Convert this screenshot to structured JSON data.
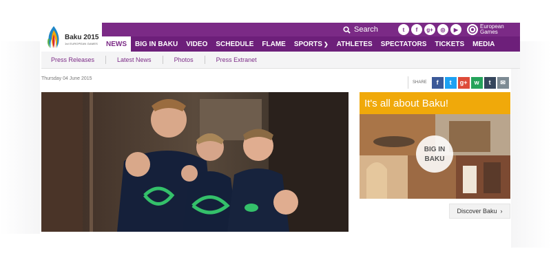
{
  "brand": {
    "name": "Baku 2015",
    "subtitle": "1st EUROPEAN GAMES"
  },
  "topbar": {
    "search_label": "Search",
    "social_icons": [
      "twitter-icon",
      "facebook-icon",
      "google-plus-icon",
      "instagram-icon",
      "youtube-icon"
    ],
    "european_games_label_line1": "European",
    "european_games_label_line2": "Games"
  },
  "nav": {
    "items": [
      {
        "label": "NEWS",
        "active": true
      },
      {
        "label": "BIG IN BAKU"
      },
      {
        "label": "VIDEO"
      },
      {
        "label": "SCHEDULE"
      },
      {
        "label": "FLAME"
      },
      {
        "label": "SPORTS"
      },
      {
        "label": "ATHLETES"
      },
      {
        "label": "SPECTATORS"
      },
      {
        "label": "TICKETS"
      },
      {
        "label": "MEDIA"
      }
    ]
  },
  "subnav": {
    "items": [
      "Press Releases",
      "Latest News",
      "Photos",
      "Press Extranet"
    ]
  },
  "article": {
    "date": "Thursday 04 June 2015"
  },
  "share": {
    "label": "SHARE",
    "buttons": [
      {
        "name": "facebook",
        "glyph": "f",
        "color": "#3b5998"
      },
      {
        "name": "twitter",
        "glyph": "t",
        "color": "#1da1f2"
      },
      {
        "name": "google-plus",
        "glyph": "g+",
        "color": "#dd4b39"
      },
      {
        "name": "whatsapp",
        "glyph": "w",
        "color": "#25a35a"
      },
      {
        "name": "tumblr",
        "glyph": "t",
        "color": "#35465c"
      },
      {
        "name": "email",
        "glyph": "✉",
        "color": "#7d8b94"
      }
    ]
  },
  "promo": {
    "title": "It's all about Baku!",
    "image_text_line1": "BIG IN",
    "image_text_line2": "BAKU",
    "button_label": "Discover Baku",
    "button_arrow": "›"
  },
  "colors": {
    "brand_purple": "#7b2a86",
    "nav_purple": "#6d1f7a",
    "promo_orange": "#f0a90a"
  }
}
